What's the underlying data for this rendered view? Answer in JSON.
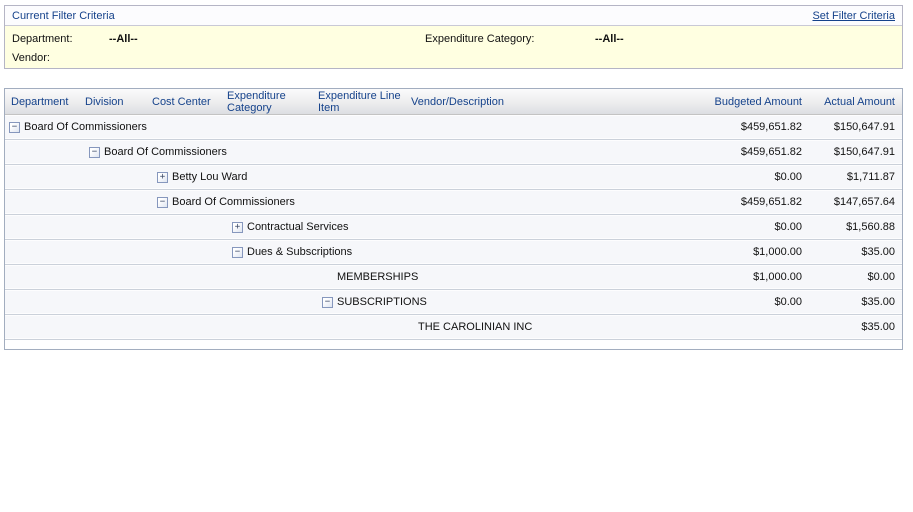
{
  "filter": {
    "title": "Current Filter Criteria",
    "set_link": "Set Filter Criteria",
    "fields": [
      {
        "label": "Department:",
        "value": "--All--"
      },
      {
        "label": "Expenditure Category:",
        "value": "--All--"
      },
      {
        "label": "Vendor:",
        "value": ""
      }
    ]
  },
  "grid": {
    "columns": [
      "Department",
      "Division",
      "Cost Center",
      "Expenditure Category",
      "Expenditure Line Item",
      "Vendor/Description",
      "Budgeted Amount",
      "Actual Amount"
    ],
    "rows": [
      {
        "level": 0,
        "icon": "minus",
        "label": "Board Of Commissioners",
        "budgeted": "$459,651.82",
        "actual": "$150,647.91"
      },
      {
        "level": 1,
        "icon": "minus",
        "label": "Board Of Commissioners",
        "budgeted": "$459,651.82",
        "actual": "$150,647.91"
      },
      {
        "level": 2,
        "icon": "plus",
        "label": "Betty Lou Ward",
        "budgeted": "$0.00",
        "actual": "$1,711.87"
      },
      {
        "level": 2,
        "icon": "minus",
        "label": "Board Of Commissioners",
        "budgeted": "$459,651.82",
        "actual": "$147,657.64"
      },
      {
        "level": 3,
        "icon": "plus",
        "label": "Contractual Services",
        "budgeted": "$0.00",
        "actual": "$1,560.88"
      },
      {
        "level": 3,
        "icon": "minus",
        "label": "Dues & Subscriptions",
        "budgeted": "$1,000.00",
        "actual": "$35.00"
      },
      {
        "level": 4,
        "icon": null,
        "label": "MEMBERSHIPS",
        "budgeted": "$1,000.00",
        "actual": "$0.00"
      },
      {
        "level": 4,
        "icon": "minus",
        "label": "SUBSCRIPTIONS",
        "budgeted": "$0.00",
        "actual": "$35.00"
      },
      {
        "level": 5,
        "icon": null,
        "label": "THE CAROLINIAN INC",
        "budgeted": "",
        "actual": "$35.00"
      }
    ]
  },
  "colors": {
    "link_blue": "#15428b",
    "filter_panel_bg": "#ffffe1",
    "header_text": "#15428b",
    "row_bg": "#f6f7fa"
  },
  "icon_glyphs": {
    "minus": "−",
    "plus": "+"
  }
}
